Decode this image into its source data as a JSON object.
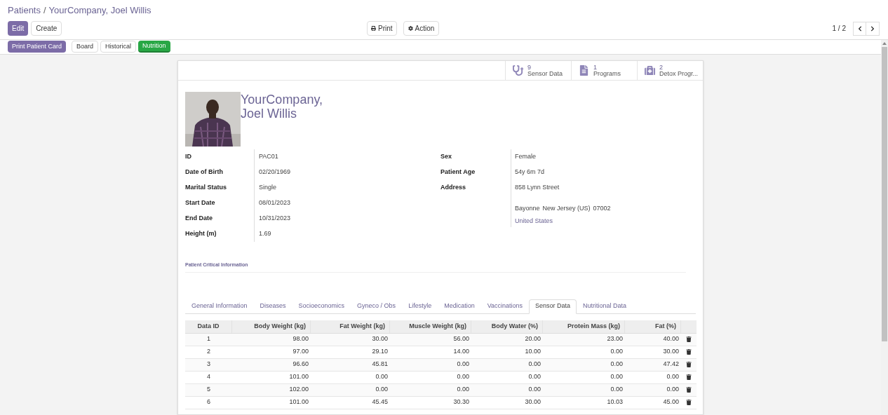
{
  "breadcrumb": {
    "parent": "Patients",
    "separator": "/",
    "current": "YourCompany, Joel Willis"
  },
  "toolbar": {
    "edit": "Edit",
    "create": "Create",
    "print": "Print",
    "action": "Action",
    "pager": "1 / 2"
  },
  "statusbar": {
    "print_card": "Print Patient Card",
    "buttons": [
      {
        "label": "Board",
        "selected": false
      },
      {
        "label": "Historical",
        "selected": false
      },
      {
        "label": "Nutrition",
        "selected": true
      }
    ]
  },
  "smart_buttons": [
    {
      "kind": "stethoscope",
      "count": "9",
      "label": "Sensor Data"
    },
    {
      "kind": "document",
      "count": "1",
      "label": "Programs"
    },
    {
      "kind": "medkit",
      "count": "2",
      "label": "Detox Progr..."
    }
  ],
  "patient": {
    "name_line_1": "YourCompany,",
    "name_line_2": "Joel Willis"
  },
  "left_fields": [
    {
      "label": "ID",
      "value": "PAC01"
    },
    {
      "label": "Date of Birth",
      "value": "02/20/1969"
    },
    {
      "label": "Marital Status",
      "value": "Single"
    },
    {
      "label": "Start Date",
      "value": "08/01/2023"
    },
    {
      "label": "End Date",
      "value": "10/31/2023"
    },
    {
      "label": "Height (m)",
      "value": "1.69"
    }
  ],
  "right_fields": [
    {
      "label": "Sex",
      "value": "Female"
    },
    {
      "label": "Patient Age",
      "value": "54y 6m 7d"
    },
    {
      "label": "Address",
      "value": "858 Lynn Street"
    }
  ],
  "address": {
    "city": "Bayonne",
    "state": "New Jersey (US)",
    "zip": "07002",
    "country": "United States"
  },
  "section_title": "Patient Critical Information",
  "tabs": [
    {
      "label": "General Information",
      "selected": false
    },
    {
      "label": "Diseases",
      "selected": false
    },
    {
      "label": "Socioeconomics",
      "selected": false
    },
    {
      "label": "Gyneco / Obs",
      "selected": false
    },
    {
      "label": "Lifestyle",
      "selected": false
    },
    {
      "label": "Medication",
      "selected": false
    },
    {
      "label": "Vaccinations",
      "selected": false
    },
    {
      "label": "Sensor Data",
      "selected": true
    },
    {
      "label": "Nutritional Data",
      "selected": false
    }
  ],
  "table": {
    "columns": [
      "Data ID",
      "Body Weight (kg)",
      "Fat Weight (kg)",
      "Muscle Weight (kg)",
      "Body Water (%)",
      "Protein Mass (kg)",
      "Fat (%)"
    ],
    "rows": [
      [
        "1",
        "98.00",
        "30.00",
        "56.00",
        "20.00",
        "23.00",
        "40.00"
      ],
      [
        "2",
        "97.00",
        "29.10",
        "14.00",
        "10.00",
        "0.00",
        "30.00"
      ],
      [
        "3",
        "96.60",
        "45.81",
        "0.00",
        "0.00",
        "0.00",
        "47.42"
      ],
      [
        "4",
        "101.00",
        "0.00",
        "0.00",
        "0.00",
        "0.00",
        "0.00"
      ],
      [
        "5",
        "102.00",
        "0.00",
        "0.00",
        "0.00",
        "0.00",
        "0.00"
      ],
      [
        "6",
        "101.00",
        "45.45",
        "30.30",
        "30.00",
        "10.03",
        "45.00"
      ]
    ]
  }
}
